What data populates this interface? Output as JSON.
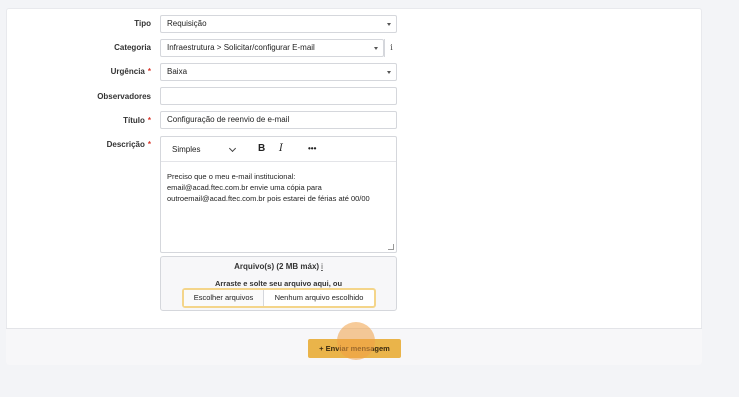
{
  "form": {
    "tipo": {
      "label": "Tipo",
      "value": "Requisição"
    },
    "categoria": {
      "label": "Categoria",
      "value": "Infraestrutura > Solicitar/configurar E-mail",
      "info_icon": "i"
    },
    "urgencia": {
      "label": "Urgência",
      "required_mark": "*",
      "value": "Baixa"
    },
    "observadores": {
      "label": "Observadores",
      "value": ""
    },
    "titulo": {
      "label": "Título",
      "required_mark": "*",
      "value": "Configuração de reenvio de e-mail"
    },
    "descricao": {
      "label": "Descrição",
      "required_mark": "*",
      "toolbar": {
        "format": "Simples",
        "bold": "B",
        "italic": "I",
        "more": "•••"
      },
      "lines": [
        "Preciso que o meu e-mail institucional:",
        "email@acad.ftec.com.br envie uma cópia para",
        "outroemail@acad.ftec.com.br pois estarei de férias até 00/00"
      ]
    },
    "arquivos": {
      "title": "Arquivo(s) (2 MB máx)",
      "info_icon": "i",
      "hint": "Arraste e solte seu arquivo aqui, ou",
      "choose_button": "Escolher arquivos",
      "status": "Nenhum arquivo escolhido"
    }
  },
  "footer": {
    "send_button": "+ Enviar mensagem"
  },
  "colors": {
    "accent": "#eab44a",
    "required": "#d9362b",
    "picker_focus": "#f4d58a"
  }
}
